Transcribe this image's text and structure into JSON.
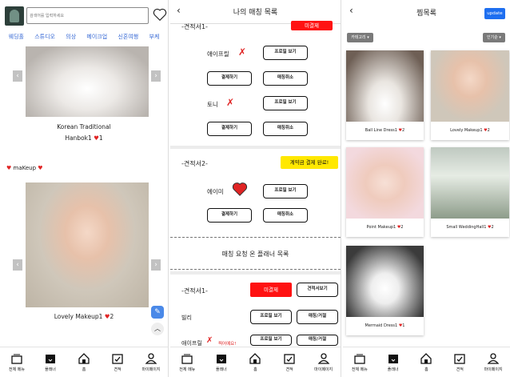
{
  "panel1": {
    "search_placeholder": "검색어를 입력하세요",
    "categories": [
      "웨딩홀",
      "스튜디오",
      "의상",
      "메이크업",
      "신혼여행",
      "부케"
    ],
    "item1": {
      "title_line1": "Korean Traditional",
      "title_line2": "Hanbok1",
      "likes": "1"
    },
    "section_label": "maKeup",
    "item2": {
      "title": "Lovely Makeup1",
      "likes": "2"
    }
  },
  "panel2": {
    "title": "나의 매칭 목록",
    "est1_label": "-견적서1-",
    "est1_tag": "미결제",
    "planner_a": "애이프릴",
    "planner_b": "토니",
    "profile_btn": "프로필 보기",
    "pay_btn": "결제하기",
    "cancel_btn": "매칭취소",
    "est2_label": "-견적서2-",
    "est2_tag": "계약금 결제 완료!",
    "planner_c": "에이미",
    "requests_title": "매칭 요청 온 플래너 목록",
    "req_est_label": "-견적서1-",
    "req_tag": "미결제",
    "view_est_btn": "견적서보기",
    "req_planner_a": "빌리",
    "req_planner_b": "애이프릴",
    "req_planner_b_note": "찍어예요!",
    "accept_btn": "매칭/거절"
  },
  "panel3": {
    "title": "찜목록",
    "update_btn": "update",
    "filter_left": "카테고리",
    "filter_right": "인기순",
    "cards": [
      {
        "name": "Ball Line Dress1",
        "likes": "2"
      },
      {
        "name": "Lovely Makeup1",
        "likes": "2"
      },
      {
        "name": "Point Makeup1",
        "likes": "2"
      },
      {
        "name": "Small WeddingHall1",
        "likes": "2"
      },
      {
        "name": "Mermaid Dress1",
        "likes": "1"
      }
    ]
  },
  "tabbar": [
    "전체 메뉴",
    "플래너",
    "홈",
    "견적",
    "마이페이지"
  ],
  "colors": {
    "accent_blue": "#1e6ff0",
    "category_blue": "#3467d4",
    "red": "#ff1212",
    "yellow": "#ffe800"
  }
}
